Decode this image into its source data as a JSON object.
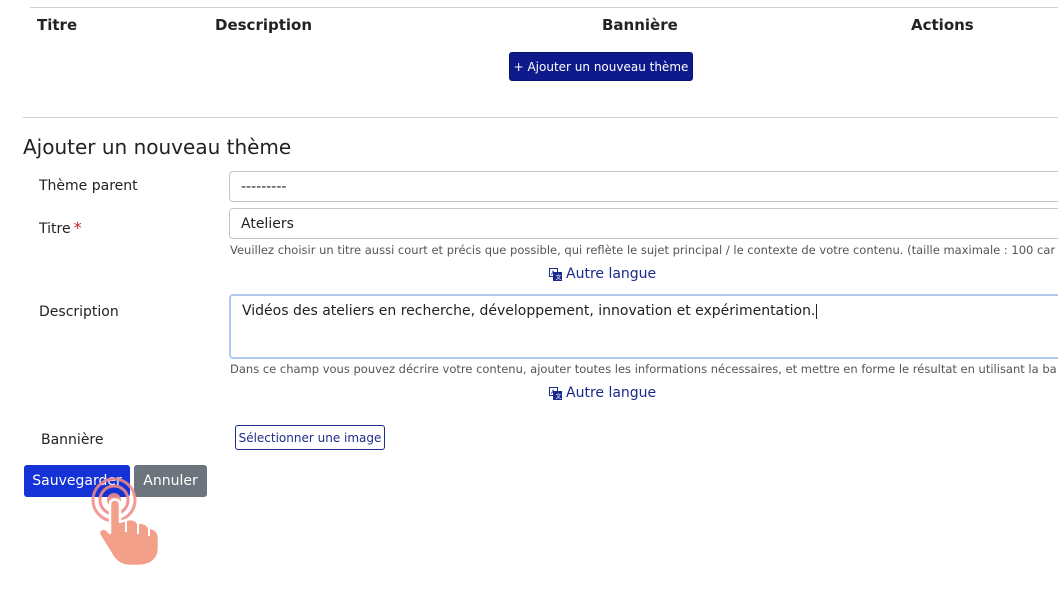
{
  "table": {
    "headers": [
      "Titre",
      "Description",
      "Bannière",
      "Actions"
    ],
    "add_button": "+ Ajouter un nouveau thème"
  },
  "form": {
    "heading": "Ajouter un nouveau thème",
    "parent": {
      "label": "Thème parent",
      "value": "---------"
    },
    "title": {
      "label": "Titre",
      "required_mark": "*",
      "value": "Ateliers",
      "help": "Veuillez choisir un titre aussi court et précis que possible, qui reflète le sujet principal / le contexte de votre contenu. (taille maximale : 100 car",
      "other_language": "Autre langue"
    },
    "description": {
      "label": "Description",
      "value": "Vidéos des ateliers en recherche, développement, innovation et expérimentation.",
      "help": "Dans ce champ vous pouvez décrire votre contenu, ajouter toutes les informations nécessaires, et mettre en forme le résultat en utilisant la ba",
      "other_language": "Autre langue"
    },
    "banner": {
      "label": "Bannière",
      "select_button": "Sélectionner une image"
    },
    "save_button": "Sauvegarder",
    "cancel_button": "Annuler"
  },
  "icons": {
    "translate": "translate-icon",
    "cursor": "hand-pointer-icon"
  },
  "colors": {
    "primary_dark": "#0e1a8c",
    "save": "#1432d6",
    "cancel": "#6c757d",
    "required": "#cc1d1d",
    "link": "#1a2a8c"
  }
}
